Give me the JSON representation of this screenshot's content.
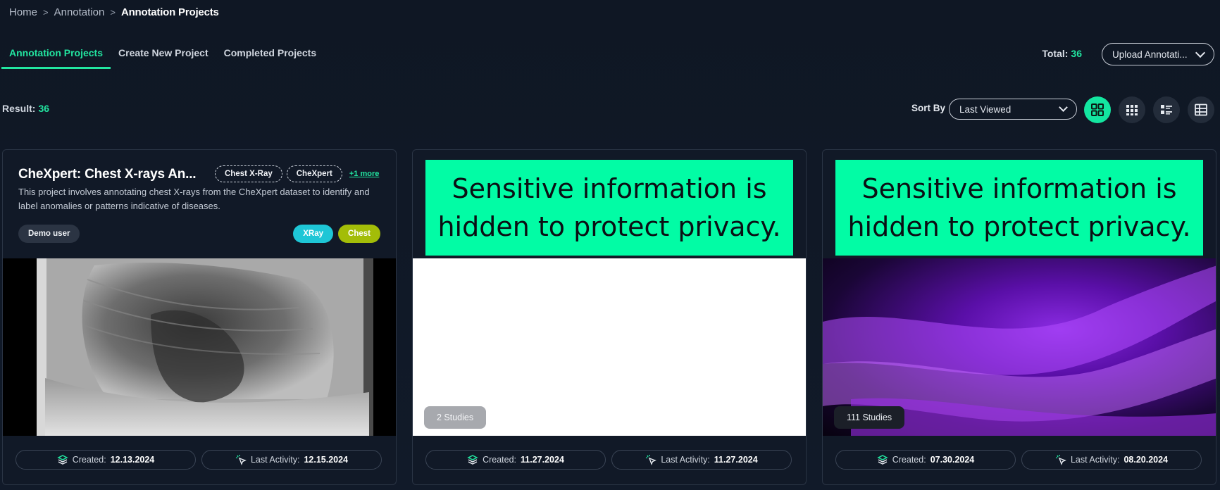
{
  "breadcrumb": {
    "items": [
      "Home",
      "Annotation",
      "Annotation Projects"
    ],
    "separator": ">"
  },
  "tabs": [
    {
      "label": "Annotation Projects",
      "active": true
    },
    {
      "label": "Create New Project",
      "active": false
    },
    {
      "label": "Completed Projects",
      "active": false
    }
  ],
  "total": {
    "label": "Total:",
    "value": "36"
  },
  "upload": {
    "label": "Upload Annotati..."
  },
  "result": {
    "label": "Result:",
    "value": "36"
  },
  "sort": {
    "label": "Sort By",
    "selected": "Last Viewed"
  },
  "view_modes": [
    "grid-large-icon",
    "grid-small-icon",
    "list-detail-icon",
    "table-icon"
  ],
  "privacy_text": "Sensitive information is hidden to protect privacy.",
  "cards": [
    {
      "title": "CheXpert: Chest X-rays An...",
      "chips": [
        "Chest X-Ray",
        "CheXpert"
      ],
      "more": "+1 more",
      "description": "This project involves annotating chest X-rays from the CheXpert dataset to identify and label anomalies or patterns indicative of diseases.",
      "user": "Demo user",
      "tags": [
        "XRay",
        "Chest"
      ],
      "created_label": "Created:",
      "created": "12.13.2024",
      "activity_label": "Last Activity:",
      "activity": "12.15.2024"
    },
    {
      "studies": "2 Studies",
      "created_label": "Created:",
      "created": "11.27.2024",
      "activity_label": "Last Activity:",
      "activity": "11.27.2024"
    },
    {
      "studies": "111 Studies",
      "created_label": "Created:",
      "created": "07.30.2024",
      "activity_label": "Last Activity:",
      "activity": "08.20.2024"
    }
  ],
  "colors": {
    "accent": "#22e5a0",
    "privacy": "#02fca5",
    "xray_tag": "#1ec6d6",
    "chest_tag": "#a3bd08"
  }
}
